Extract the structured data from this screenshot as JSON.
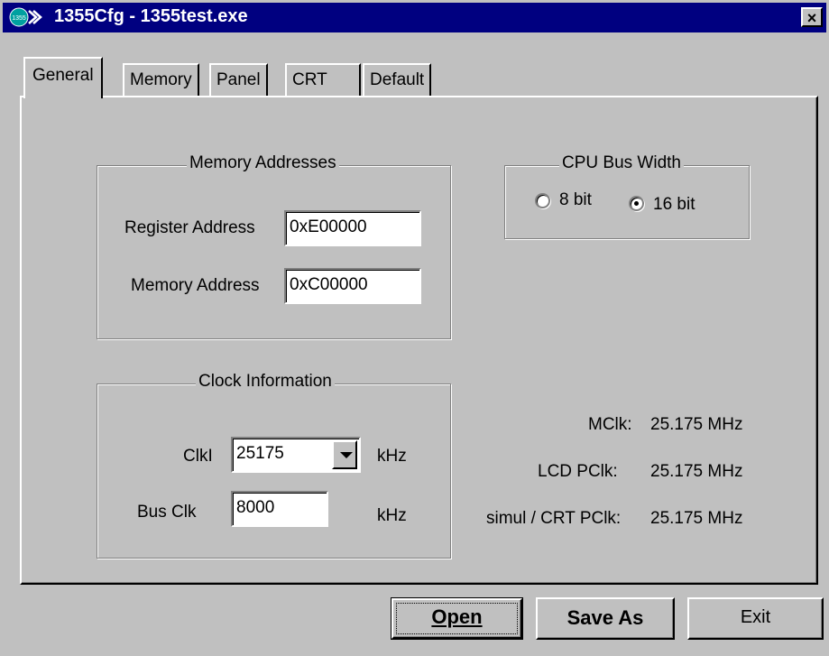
{
  "window": {
    "title": "1355Cfg - 1355test.exe",
    "icon_label": "1355",
    "close_label": "×"
  },
  "tabs": [
    {
      "label": "General",
      "active": true
    },
    {
      "label": "Memory",
      "active": false
    },
    {
      "label": "Panel",
      "active": false
    },
    {
      "label": "CRT",
      "active": false
    },
    {
      "label": "Default",
      "active": false
    }
  ],
  "memory_addresses": {
    "title": "Memory Addresses",
    "register_label": "Register Address",
    "register_value": "0xE00000",
    "memory_label": "Memory Address",
    "memory_value": "0xC00000"
  },
  "cpu_bus_width": {
    "title": "CPU Bus Width",
    "options": [
      {
        "label": "8 bit",
        "selected": false
      },
      {
        "label": "16 bit",
        "selected": true
      }
    ]
  },
  "clock_information": {
    "title": "Clock Information",
    "clki_label": "ClkI",
    "clki_value": "25175",
    "clki_unit": "kHz",
    "busclk_label": "Bus Clk",
    "busclk_value": "8000",
    "busclk_unit": "kHz"
  },
  "clock_readouts": [
    {
      "label": "MClk:",
      "value": "25.175 MHz"
    },
    {
      "label": "LCD PClk:",
      "value": "25.175 MHz"
    },
    {
      "label": "simul / CRT PClk:",
      "value": "25.175 MHz"
    }
  ],
  "buttons": {
    "open": "Open",
    "save_as": "Save As",
    "exit": "Exit"
  },
  "colors": {
    "title_bar": "#000080",
    "face": "#c0c0c0"
  }
}
